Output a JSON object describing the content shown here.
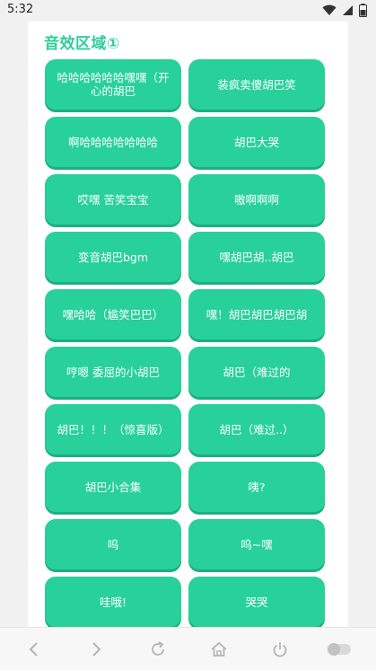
{
  "status": {
    "time": "5:32"
  },
  "section": {
    "title": "音效区域①"
  },
  "buttons": [
    "哈哈哈哈哈哈嘿嘿（开心的胡巴",
    "装疯卖傻胡巴笑",
    "啊哈哈哈哈哈哈哈",
    "胡巴大哭",
    "哎嘿 苦笑宝宝",
    "嗷啊啊啊",
    "变音胡巴bgm",
    "嘿胡巴胡..胡巴",
    "嘿哈哈（尴笑巴巴）",
    "嘿！胡巴胡巴胡巴胡",
    "哼嗯 委屈的小胡巴",
    "胡巴（难过的",
    "胡巴！！！（惊喜版）",
    "胡巴（难过..）",
    "胡巴小合集",
    "咦?",
    "呜",
    "呜~嘿",
    "哇哦!",
    "哭哭"
  ],
  "colors": {
    "accent": "#2bcf96",
    "button": "#28d199",
    "button_shadow": "#1fae7e"
  },
  "nav_icons": [
    "back-icon",
    "forward-icon",
    "refresh-icon",
    "home-icon",
    "power-icon",
    "toggle-icon"
  ]
}
